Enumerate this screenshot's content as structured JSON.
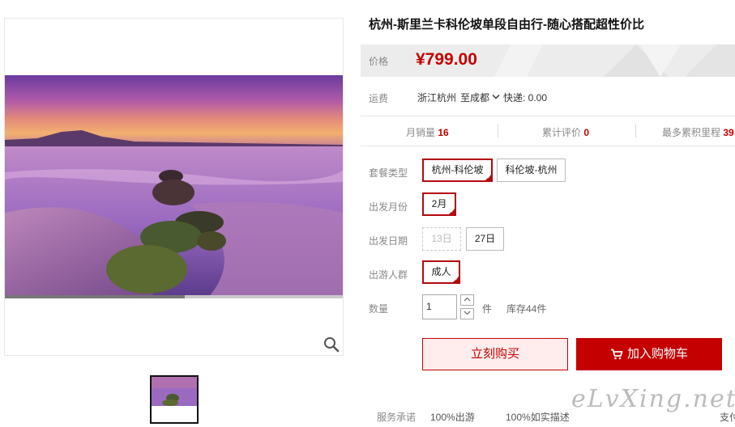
{
  "product": {
    "title": "杭州-斯里兰卡科伦坡单段自由行-随心搭配超性价比",
    "price_label": "价格",
    "price": "¥799.00"
  },
  "shipping": {
    "label": "运费",
    "origin": "浙江杭州",
    "destination": "至成都",
    "express": "快递: 0.00"
  },
  "stats": [
    {
      "label": "月销量",
      "value": "16"
    },
    {
      "label": "累计评价",
      "value": "0"
    },
    {
      "label": "最多累积里程",
      "value": "39"
    }
  ],
  "options": {
    "package": {
      "label": "套餐类型",
      "choices": [
        "杭州-科伦坡",
        "科伦坡-杭州"
      ],
      "selected": "杭州-科伦坡"
    },
    "month": {
      "label": "出发月份",
      "choices": [
        "2月"
      ],
      "selected": "2月"
    },
    "date": {
      "label": "出发日期",
      "choices": [
        "13日",
        "27日"
      ],
      "disabled": [
        "13日"
      ]
    },
    "group": {
      "label": "出游人群",
      "choices": [
        "成人"
      ],
      "selected": "成人"
    }
  },
  "quantity": {
    "label": "数量",
    "value": "1",
    "unit": "件",
    "stock": "库存44件"
  },
  "buttons": {
    "buy_now": "立刻购买",
    "add_to_cart": "加入购物车"
  },
  "service": {
    "label": "服务承诺",
    "items": [
      "100%出游",
      "100%如实描述",
      "支付"
    ]
  },
  "watermark": "eLvXing.net",
  "colors": {
    "accent": "#c40000",
    "selected_border": "#b4080f",
    "price_bg": "#ececec"
  },
  "icons": [
    "zoom-icon",
    "cart-icon",
    "chevron-down-icon",
    "check-corner-icon"
  ]
}
